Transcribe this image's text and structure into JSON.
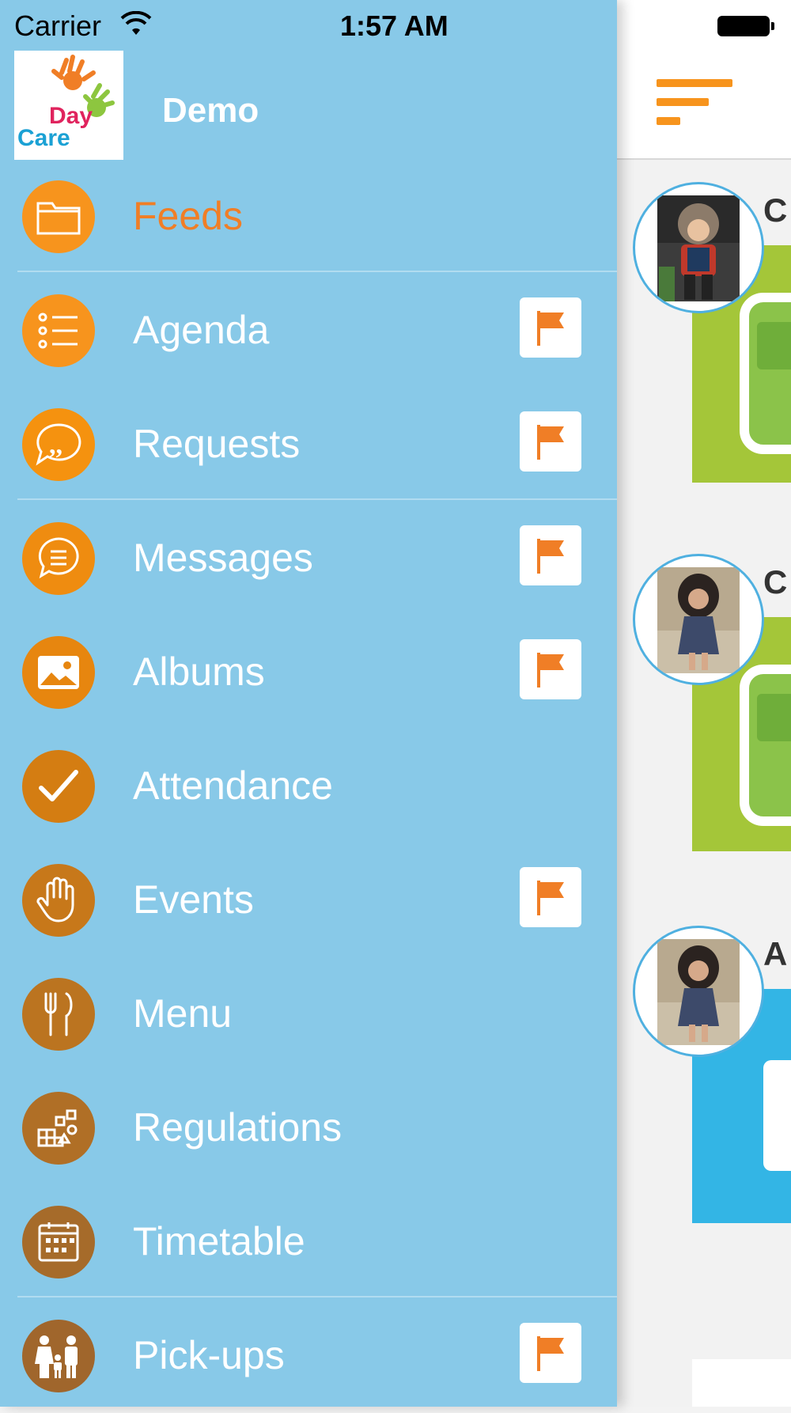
{
  "status_bar": {
    "carrier": "Carrier",
    "time": "1:57 AM"
  },
  "drawer": {
    "app_name": "Demo",
    "logo": {
      "line1": "Day",
      "line2": "Care"
    },
    "menu": [
      {
        "label": "Feeds",
        "icon": "folder-icon",
        "flag": false,
        "active": true
      },
      {
        "label": "Agenda",
        "icon": "list-icon",
        "flag": true,
        "active": false
      },
      {
        "label": "Requests",
        "icon": "quote-bubble-icon",
        "flag": true,
        "active": false
      },
      {
        "label": "Messages",
        "icon": "message-icon",
        "flag": true,
        "active": false
      },
      {
        "label": "Albums",
        "icon": "photo-icon",
        "flag": true,
        "active": false
      },
      {
        "label": "Attendance",
        "icon": "checkmark-icon",
        "flag": false,
        "active": false
      },
      {
        "label": "Events",
        "icon": "hand-icon",
        "flag": true,
        "active": false
      },
      {
        "label": "Menu",
        "icon": "cutlery-icon",
        "flag": false,
        "active": false
      },
      {
        "label": "Regulations",
        "icon": "blocks-icon",
        "flag": false,
        "active": false
      },
      {
        "label": "Timetable",
        "icon": "calendar-icon",
        "flag": false,
        "active": false
      },
      {
        "label": "Pick-ups",
        "icon": "family-icon",
        "flag": true,
        "active": false
      }
    ]
  },
  "main": {
    "cards": [
      {
        "title_initial": "C",
        "image_kind": "bus",
        "color": "#a4c639"
      },
      {
        "title_initial": "C",
        "image_kind": "bus",
        "color": "#a4c639"
      },
      {
        "title_initial": "A",
        "image_kind": "document",
        "color": "#33b5e5"
      }
    ]
  },
  "colors": {
    "drawer_bg": "#88c9e8",
    "accent_orange": "#f7941d",
    "active_label": "#f07e26",
    "flag": "#f07e26"
  }
}
